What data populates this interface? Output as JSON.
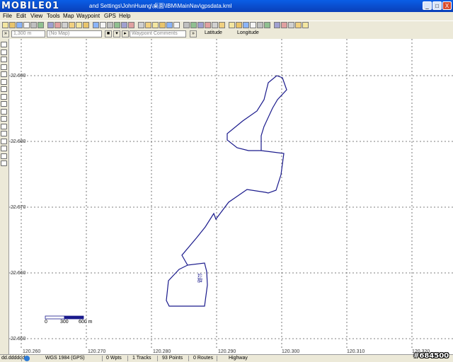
{
  "window": {
    "logo": "MOBILE01",
    "title": "and Settings\\JohnHuang\\桌面\\IBM\\MainNav\\gpsdata.kml",
    "minimize": "_",
    "maximize": "□",
    "close": "X"
  },
  "menu": {
    "items": [
      "File",
      "Edit",
      "View",
      "Tools",
      "Map",
      "Waypoint",
      "GPS",
      "Help"
    ]
  },
  "toolbar2": {
    "distance": "1,300 m",
    "map_select": "(No Map)",
    "waypoint_comments": "Waypoint Comments",
    "latitude_label": "Latitude",
    "longitude_label": "Longitude"
  },
  "map": {
    "y_labels": [
      "22.690",
      "22.680",
      "22.670",
      "22.660",
      "22.650"
    ],
    "x_labels": [
      "120.260",
      "120.270",
      "120.280",
      "120.290",
      "120.300",
      "120.310",
      "120.320"
    ],
    "track_label": "公路",
    "scale": [
      "0",
      "300",
      "600 m"
    ]
  },
  "status": {
    "coord_format": "dd.dddddd",
    "datum": "WGS 1984 (GPS)",
    "waypoints": "0 Wpts",
    "tracks": "1 Tracks",
    "points": "93 Points",
    "routes": "0 Routes",
    "road": "Highway"
  },
  "watermark": "#684500"
}
